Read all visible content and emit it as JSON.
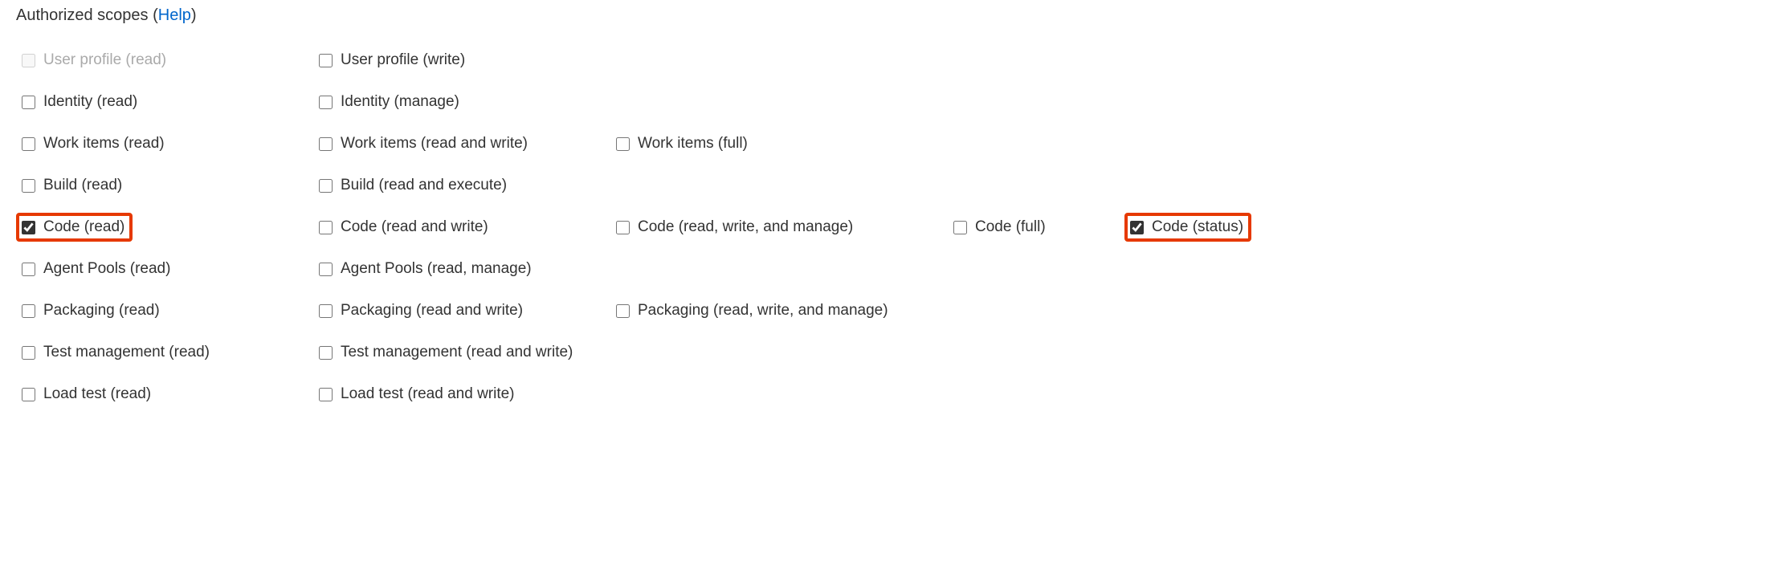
{
  "heading": {
    "prefix": "Authorized scopes (",
    "help": "Help",
    "suffix": ")"
  },
  "scopes": {
    "rows": [
      [
        {
          "id": "user-profile-read",
          "label": "User profile (read)",
          "checked": false,
          "disabled": true,
          "highlighted": false
        },
        {
          "id": "user-profile-write",
          "label": "User profile (write)",
          "checked": false,
          "disabled": false,
          "highlighted": false
        }
      ],
      [
        {
          "id": "identity-read",
          "label": "Identity (read)",
          "checked": false,
          "disabled": false,
          "highlighted": false
        },
        {
          "id": "identity-manage",
          "label": "Identity (manage)",
          "checked": false,
          "disabled": false,
          "highlighted": false
        }
      ],
      [
        {
          "id": "work-items-read",
          "label": "Work items (read)",
          "checked": false,
          "disabled": false,
          "highlighted": false
        },
        {
          "id": "work-items-read-write",
          "label": "Work items (read and write)",
          "checked": false,
          "disabled": false,
          "highlighted": false
        },
        {
          "id": "work-items-full",
          "label": "Work items (full)",
          "checked": false,
          "disabled": false,
          "highlighted": false
        }
      ],
      [
        {
          "id": "build-read",
          "label": "Build (read)",
          "checked": false,
          "disabled": false,
          "highlighted": false
        },
        {
          "id": "build-read-execute",
          "label": "Build (read and execute)",
          "checked": false,
          "disabled": false,
          "highlighted": false
        }
      ],
      [
        {
          "id": "code-read",
          "label": "Code (read)",
          "checked": true,
          "disabled": false,
          "highlighted": true
        },
        {
          "id": "code-read-write",
          "label": "Code (read and write)",
          "checked": false,
          "disabled": false,
          "highlighted": false
        },
        {
          "id": "code-read-write-manage",
          "label": "Code (read, write, and manage)",
          "checked": false,
          "disabled": false,
          "highlighted": false
        },
        {
          "id": "code-full",
          "label": "Code (full)",
          "checked": false,
          "disabled": false,
          "highlighted": false
        },
        {
          "id": "code-status",
          "label": "Code (status)",
          "checked": true,
          "disabled": false,
          "highlighted": true
        }
      ],
      [
        {
          "id": "agent-pools-read",
          "label": "Agent Pools (read)",
          "checked": false,
          "disabled": false,
          "highlighted": false
        },
        {
          "id": "agent-pools-read-manage",
          "label": "Agent Pools (read, manage)",
          "checked": false,
          "disabled": false,
          "highlighted": false
        }
      ],
      [
        {
          "id": "packaging-read",
          "label": "Packaging (read)",
          "checked": false,
          "disabled": false,
          "highlighted": false
        },
        {
          "id": "packaging-read-write",
          "label": "Packaging (read and write)",
          "checked": false,
          "disabled": false,
          "highlighted": false
        },
        {
          "id": "packaging-read-write-manage",
          "label": "Packaging (read, write, and manage)",
          "checked": false,
          "disabled": false,
          "highlighted": false
        }
      ],
      [
        {
          "id": "test-management-read",
          "label": "Test management (read)",
          "checked": false,
          "disabled": false,
          "highlighted": false
        },
        {
          "id": "test-management-read-write",
          "label": "Test management (read and write)",
          "checked": false,
          "disabled": false,
          "highlighted": false
        }
      ],
      [
        {
          "id": "load-test-read",
          "label": "Load test (read)",
          "checked": false,
          "disabled": false,
          "highlighted": false
        },
        {
          "id": "load-test-read-write",
          "label": "Load test (read and write)",
          "checked": false,
          "disabled": false,
          "highlighted": false
        }
      ]
    ]
  }
}
